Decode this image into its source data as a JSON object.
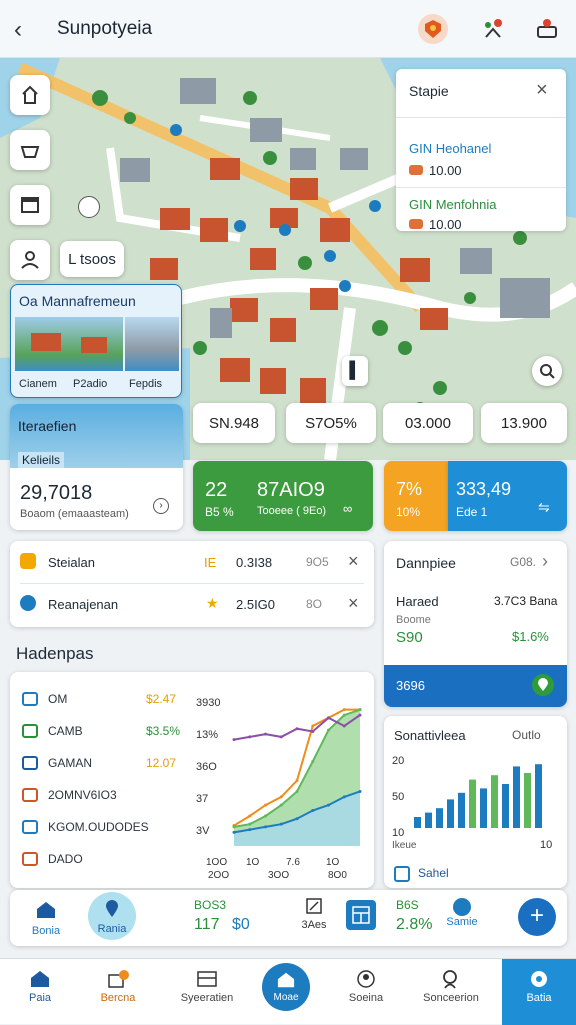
{
  "header": {
    "title": "Sunpotyeia",
    "back": "‹"
  },
  "map": {
    "pill_label": "L tsoos",
    "popup": {
      "title": "Stapie",
      "items": [
        {
          "name": "GIN Heohanel",
          "value": "10.00",
          "color": "#1d7bbf"
        },
        {
          "name": "GIN Menfohnia",
          "value": "10.00",
          "color": "#2a8f3a"
        }
      ]
    },
    "preview": {
      "title": "Oa Mannafremeun",
      "cap_left": "Cianem",
      "cap_mid": "P2adio",
      "cap_right": "Fepdis"
    }
  },
  "stats_row": [
    "SN.948",
    "S7O5%",
    "03.000",
    "13.900"
  ],
  "summary_card": {
    "title": "Iteraefien",
    "tag": "Kelieils",
    "value": "29,7018",
    "sub": "Boaom (emaaasteam)"
  },
  "green_card": {
    "value_a": "22",
    "value_b": "87AIO9",
    "sub_a": "B5 %",
    "sub_b": "Tooeee ( 9Eo)"
  },
  "orange_card": {
    "value": "7%",
    "sub": "10%"
  },
  "blue_card": {
    "value": "333,49",
    "sub": "Ede 1"
  },
  "filter_list": [
    {
      "label": "Steialan",
      "v1": "IE",
      "v2": "0.3I38",
      "v3": "9O5",
      "color": "#f2a800"
    },
    {
      "label": "Reanajenan",
      "v1": "★",
      "v2": "2.5IG0",
      "v3": "8O",
      "color": "#1d7bbf"
    }
  ],
  "detail_card": {
    "title": "Dannpiee",
    "right": "G08.",
    "row1_label": "Haraed",
    "row1_value": "3.7C3 Bana",
    "row2_label": "Boome",
    "row2_value_a": "S90",
    "row2_value_b": "$1.6%",
    "footer": "3696"
  },
  "section_title": "Hadenpas",
  "legend_list": [
    {
      "label": "OM",
      "value": "$2.47",
      "vcolor": "#e0a000",
      "icon_color": "#1d7bbf"
    },
    {
      "label": "CAMB",
      "value": "$3.5%",
      "vcolor": "#2a8f3a",
      "icon_color": "#2a8f3a"
    },
    {
      "label": "GAMAN",
      "value": "12.07",
      "vcolor": "#e0a000",
      "icon_color": "#1d5a9f"
    },
    {
      "label": "2OMNV6IO3",
      "value": "",
      "vcolor": "#333",
      "icon_color": "#d0552a"
    },
    {
      "label": "KGOM.OUDODES",
      "value": "",
      "vcolor": "#333",
      "icon_color": "#1d7bbf"
    },
    {
      "label": "DADO",
      "value": "",
      "vcolor": "#333",
      "icon_color": "#d0552a"
    }
  ],
  "chart_data": [
    {
      "type": "line",
      "y_ticks": [
        "3930",
        "13%",
        "36O",
        "37",
        "3V"
      ],
      "x_ticks": [
        "1OO",
        "1O",
        "7.6",
        "1O"
      ],
      "x_ticks2": [
        "2OO",
        "3OO",
        "8O0"
      ],
      "series": [
        {
          "values": [
            15,
            22,
            30,
            36,
            48,
            88,
            94,
            100,
            100
          ],
          "color": "#f08c1a"
        },
        {
          "values": [
            14,
            16,
            22,
            30,
            40,
            62,
            85,
            96,
            100
          ],
          "color": "#5fb85a"
        },
        {
          "values": [
            10,
            12,
            14,
            16,
            20,
            26,
            30,
            36,
            40
          ],
          "color": "#1d7bbf"
        },
        {
          "values": [
            78,
            80,
            82,
            80,
            86,
            84,
            94,
            88,
            96
          ],
          "color": "#8a4fa8"
        }
      ],
      "ylim": [
        0,
        110
      ]
    },
    {
      "type": "bar",
      "title": "Sonattivleea",
      "right_label": "Outlo",
      "y_ticks": [
        "20",
        "50",
        "10"
      ],
      "x_label": "Ikeue",
      "x_end": "10",
      "values": [
        10,
        14,
        18,
        26,
        32,
        44,
        36,
        48,
        40,
        56,
        50,
        58
      ],
      "colors": [
        "#1d7bbf",
        "#1d7bbf",
        "#1d7bbf",
        "#1d7bbf",
        "#1d7bbf",
        "#5fb85a",
        "#1d7bbf",
        "#5fb85a",
        "#1d7bbf",
        "#1d7bbf",
        "#5fb85a",
        "#1d7bbf"
      ],
      "footer": "Sahel"
    }
  ],
  "toolbar": [
    {
      "label": "Bonia",
      "color": "#1d7bbf"
    },
    {
      "label": "Rania",
      "color": "#1d7bbf"
    },
    {
      "label": "BOS3",
      "sub": "117",
      "sub_b": "$0",
      "color": "#2a8f3a"
    },
    {
      "label": "3Aes",
      "color": "#333"
    },
    {
      "label": "",
      "color": "#1d7bbf"
    },
    {
      "label": "B6S",
      "sub": "2.8%",
      "color": "#2a8f3a"
    },
    {
      "label": "Samie",
      "color": "#1d7bbf"
    }
  ],
  "bottom_nav": [
    {
      "label": "Paia"
    },
    {
      "label": "Bercna"
    },
    {
      "label": "Syeeratien"
    },
    {
      "label": "Moae"
    },
    {
      "label": "Soeina"
    },
    {
      "label": "Sonceerion"
    },
    {
      "label": "Batia"
    }
  ]
}
